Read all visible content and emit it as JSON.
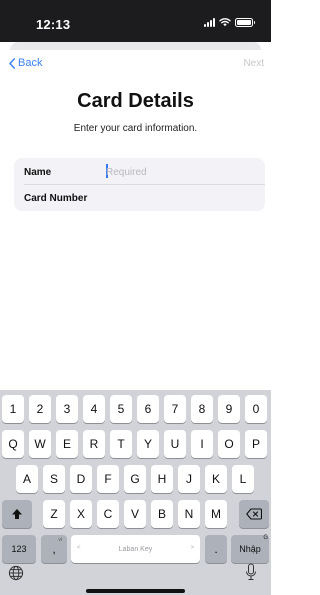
{
  "status_bar": {
    "time": "12:13"
  },
  "nav": {
    "back_label": "Back",
    "next_label": "Next"
  },
  "header": {
    "title": "Card Details",
    "subtitle": "Enter your card information."
  },
  "form": {
    "fields": [
      {
        "label": "Name",
        "value": "",
        "placeholder": "Required"
      },
      {
        "label": "Card Number",
        "value": "",
        "placeholder": ""
      }
    ]
  },
  "keyboard": {
    "number_row": [
      "1",
      "2",
      "3",
      "4",
      "5",
      "6",
      "7",
      "8",
      "9",
      "0"
    ],
    "row1": [
      "Q",
      "W",
      "E",
      "R",
      "T",
      "Y",
      "U",
      "I",
      "O",
      "P"
    ],
    "row2": [
      "A",
      "S",
      "D",
      "F",
      "G",
      "H",
      "J",
      "K",
      "L"
    ],
    "row3": [
      "Z",
      "X",
      "C",
      "V",
      "B",
      "N",
      "M"
    ],
    "numbers_key": "123",
    "comma_key": ",",
    "comma_hint": "vi",
    "space_label": "Laban Key",
    "space_left_arrow": "<",
    "space_right_arrow": ">",
    "period_key": ".",
    "return_key": "Nhập",
    "return_hint": "G",
    "shift_icon": "shift-icon",
    "delete_icon": "delete-icon",
    "globe_icon": "globe-icon",
    "mic_icon": "microphone-icon"
  },
  "colors": {
    "accent": "#3b82f6",
    "status_bar_bg": "#1c1c1e",
    "keyboard_bg": "#d1d3d9",
    "form_bg": "#f2f2f7"
  }
}
